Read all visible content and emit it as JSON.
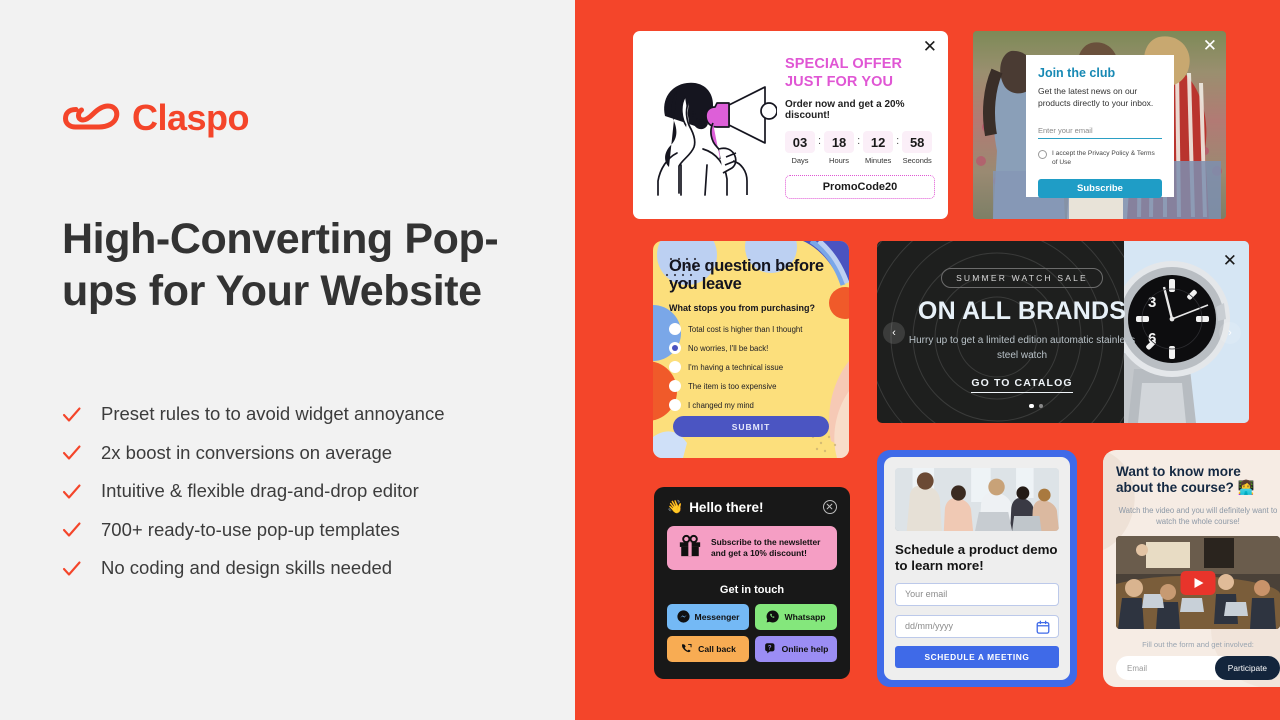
{
  "brand": {
    "name": "Claspo",
    "logo_icon": "claspo-cloud-logo",
    "accent_color": "#f4452a",
    "left_bg": "#f2f2f2",
    "right_bg": "#f4452a"
  },
  "hero": {
    "headline": "High-Converting Pop-ups for Your Website",
    "features": [
      "Preset rules to to avoid widget annoyance",
      "2x boost in conversions on average",
      "Intuitive & flexible drag-and-drop editor",
      "700+ ready-to-use pop-up templates",
      "No coding and design skills needed"
    ]
  },
  "popups": {
    "special_offer": {
      "title_line1": "SPECIAL OFFER",
      "title_line2": "JUST FOR YOU",
      "subtitle": "Order now and get a 20% discount!",
      "timer": [
        {
          "value": "03",
          "label": "Days"
        },
        {
          "value": "18",
          "label": "Hours"
        },
        {
          "value": "12",
          "label": "Minutes"
        },
        {
          "value": "58",
          "label": "Seconds"
        }
      ],
      "separator": ":",
      "promo_code": "PromoCode20",
      "close_icon": "close-icon",
      "illustration": "woman-with-megaphone",
      "accent_color": "#e056d4"
    },
    "join_club": {
      "title": "Join the club",
      "subtitle": "Get the latest news on our products directly to your inbox.",
      "email_placeholder": "Enter your email",
      "consent": "I accept the Privacy Policy & Terms of Use",
      "button": "Subscribe",
      "close_icon": "close-icon",
      "accent_color": "#1f9dc6"
    },
    "survey": {
      "title": "One question before you leave",
      "question": "What stops you from purchasing?",
      "options": [
        {
          "label": "Total cost is higher than I thought",
          "selected": false
        },
        {
          "label": "No worries, I'll be back!",
          "selected": true
        },
        {
          "label": "I'm having a technical issue",
          "selected": false
        },
        {
          "label": "The item is too expensive",
          "selected": false
        },
        {
          "label": "I changed my mind",
          "selected": false
        }
      ],
      "button": "SUBMIT",
      "bg_color": "#fcdf7c",
      "accent_color": "#4b55c2"
    },
    "watch_sale": {
      "badge": "SUMMER WATCH SALE",
      "heading": "ON ALL BRANDS",
      "subtitle": "Hurry up to get a limited edition automatic stainless steel watch",
      "cta": "GO TO CATALOG",
      "prev_icon": "chevron-left-icon",
      "next_icon": "chevron-right-icon",
      "close_icon": "close-icon",
      "prev_symbol": "‹",
      "next_symbol": "›",
      "slides": 2,
      "active_slide": 1
    },
    "chat_widget": {
      "wave_icon": "waving-hand-icon",
      "wave_emoji": "👋",
      "title": "Hello there!",
      "close_icon": "close-circle-icon",
      "promo_icon": "gift-icon",
      "promo_text": "Subscribe to the newsletter and get a 10% discount!",
      "section_title": "Get in touch",
      "buttons": [
        {
          "label": "Messenger",
          "icon": "messenger-icon",
          "color": "#74b9f5"
        },
        {
          "label": "Whatsapp",
          "icon": "whatsapp-icon",
          "color": "#84e77c"
        },
        {
          "label": "Call back",
          "icon": "phone-callback-icon",
          "color": "#f8ac53"
        },
        {
          "label": "Online help",
          "icon": "help-chat-icon",
          "color": "#9b8df4"
        }
      ],
      "bg_color": "#181818",
      "promo_color": "#f59ec4"
    },
    "schedule_demo": {
      "title": "Schedule a product demo to learn more!",
      "email_placeholder": "Your email",
      "date_placeholder": "dd/mm/yyyy",
      "calendar_icon": "calendar-icon",
      "button": "SCHEDULE A MEETING",
      "frame_color": "#3f6ae8",
      "photo": "office-meeting-photo"
    },
    "course": {
      "title": "Want to know more about the course?",
      "title_emoji": "👩‍💻",
      "subtitle": "Watch the video and you will definitely want to watch the whole course!",
      "play_icon": "youtube-play-icon",
      "form_label": "Fill out the form and get involved:",
      "email_placeholder": "Email",
      "button": "Participate",
      "bg_color": "#f6ece4",
      "button_color": "#13253c"
    }
  }
}
